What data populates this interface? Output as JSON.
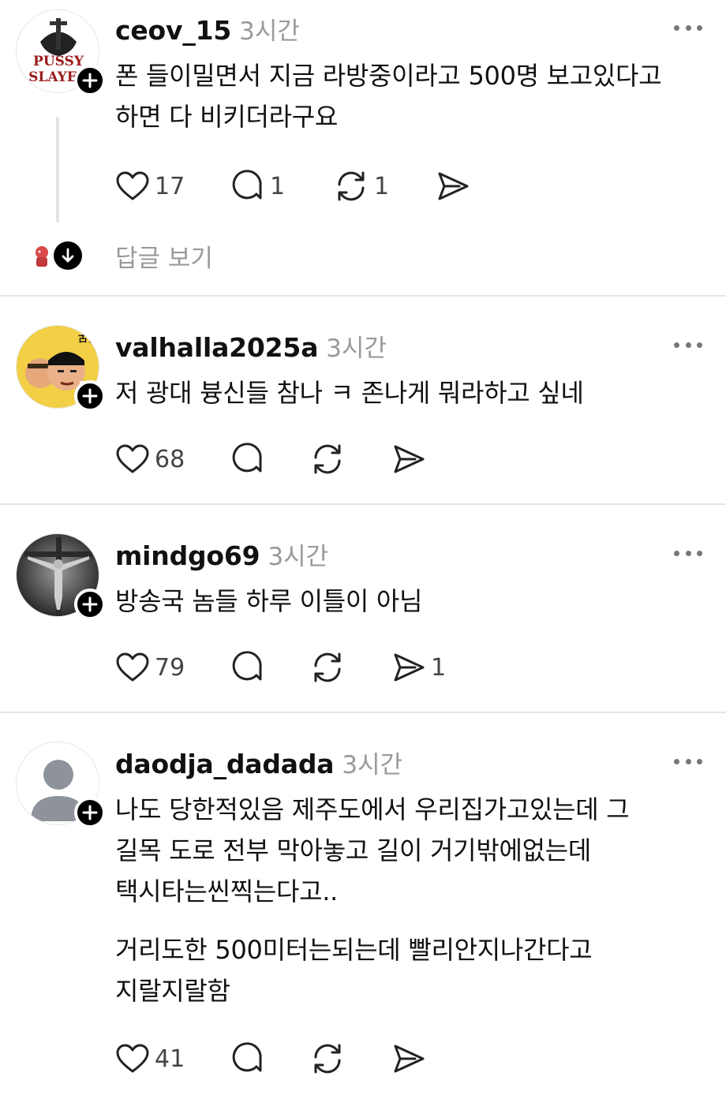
{
  "posts": [
    {
      "username": "ceov_15",
      "time": "3시간",
      "avatar_icon": "pussy-slayer-logo-avatar",
      "avatar_text": [
        "PUSSY",
        "SLAYER"
      ],
      "text": "폰 들이밀면서 지금 라방중이라고 500명 보고있다고\n하면 다 비키더라구요",
      "likes": "17",
      "comments": "1",
      "reposts": "1",
      "shares": "",
      "view_replies": "답글 보기"
    },
    {
      "username": "valhalla2025a",
      "time": "3시간",
      "avatar_icon": "cartoon-faces-avatar",
      "avatar_text": [
        "古谷"
      ],
      "text": "저 광대 븅신들 참나 ㅋ 존나게 뭐라하고 싶네",
      "likes": "68",
      "comments": "",
      "reposts": "",
      "shares": ""
    },
    {
      "username": "mindgo69",
      "time": "3시간",
      "avatar_icon": "crucifix-avatar",
      "text": "방송국 놈들 하루 이틀이 아님",
      "likes": "79",
      "comments": "",
      "reposts": "",
      "shares": "1"
    },
    {
      "username": "daodja_dadada",
      "time": "3시간",
      "avatar_icon": "default-user-avatar",
      "text": "나도 당한적있음 제주도에서 우리집가고있는데 그\n길목 도로 전부 막아놓고 길이 거기밖에없는데\n택시타는씬찍는다고..",
      "text2": "거리도한 500미터는되는데 빨리안지나간다고\n지랄지랄함",
      "likes": "41",
      "comments": "",
      "reposts": "",
      "shares": ""
    }
  ],
  "colors": {
    "text": "#111111",
    "muted": "#9a9a9a",
    "divider": "#e6e6e6",
    "icon": "#222222"
  }
}
